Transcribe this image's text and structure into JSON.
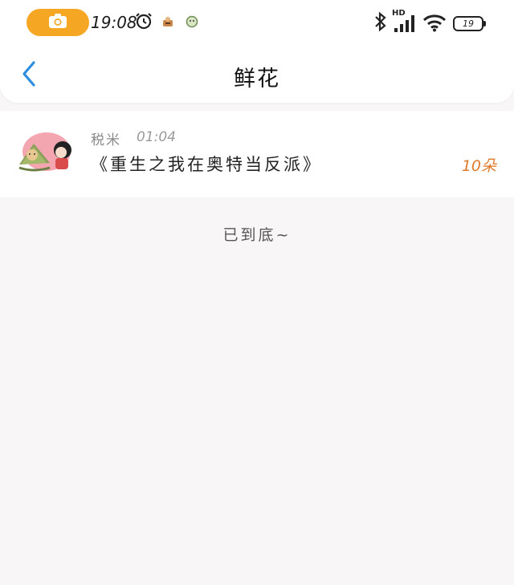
{
  "status_bar": {
    "time": "19:08",
    "battery": "19",
    "signal_label": "HD"
  },
  "header": {
    "title": "鲜花"
  },
  "gift_list": [
    {
      "user": "税米",
      "time": "01:04",
      "work": "《重生之我在奥特当反派》",
      "amount": "10朵"
    }
  ],
  "footer": {
    "end_text": "已到底~"
  },
  "colors": {
    "accent": "#f5a623",
    "back_arrow": "#2d8ddf",
    "amount": "#e07b2e",
    "background": "#f8f6f7"
  }
}
